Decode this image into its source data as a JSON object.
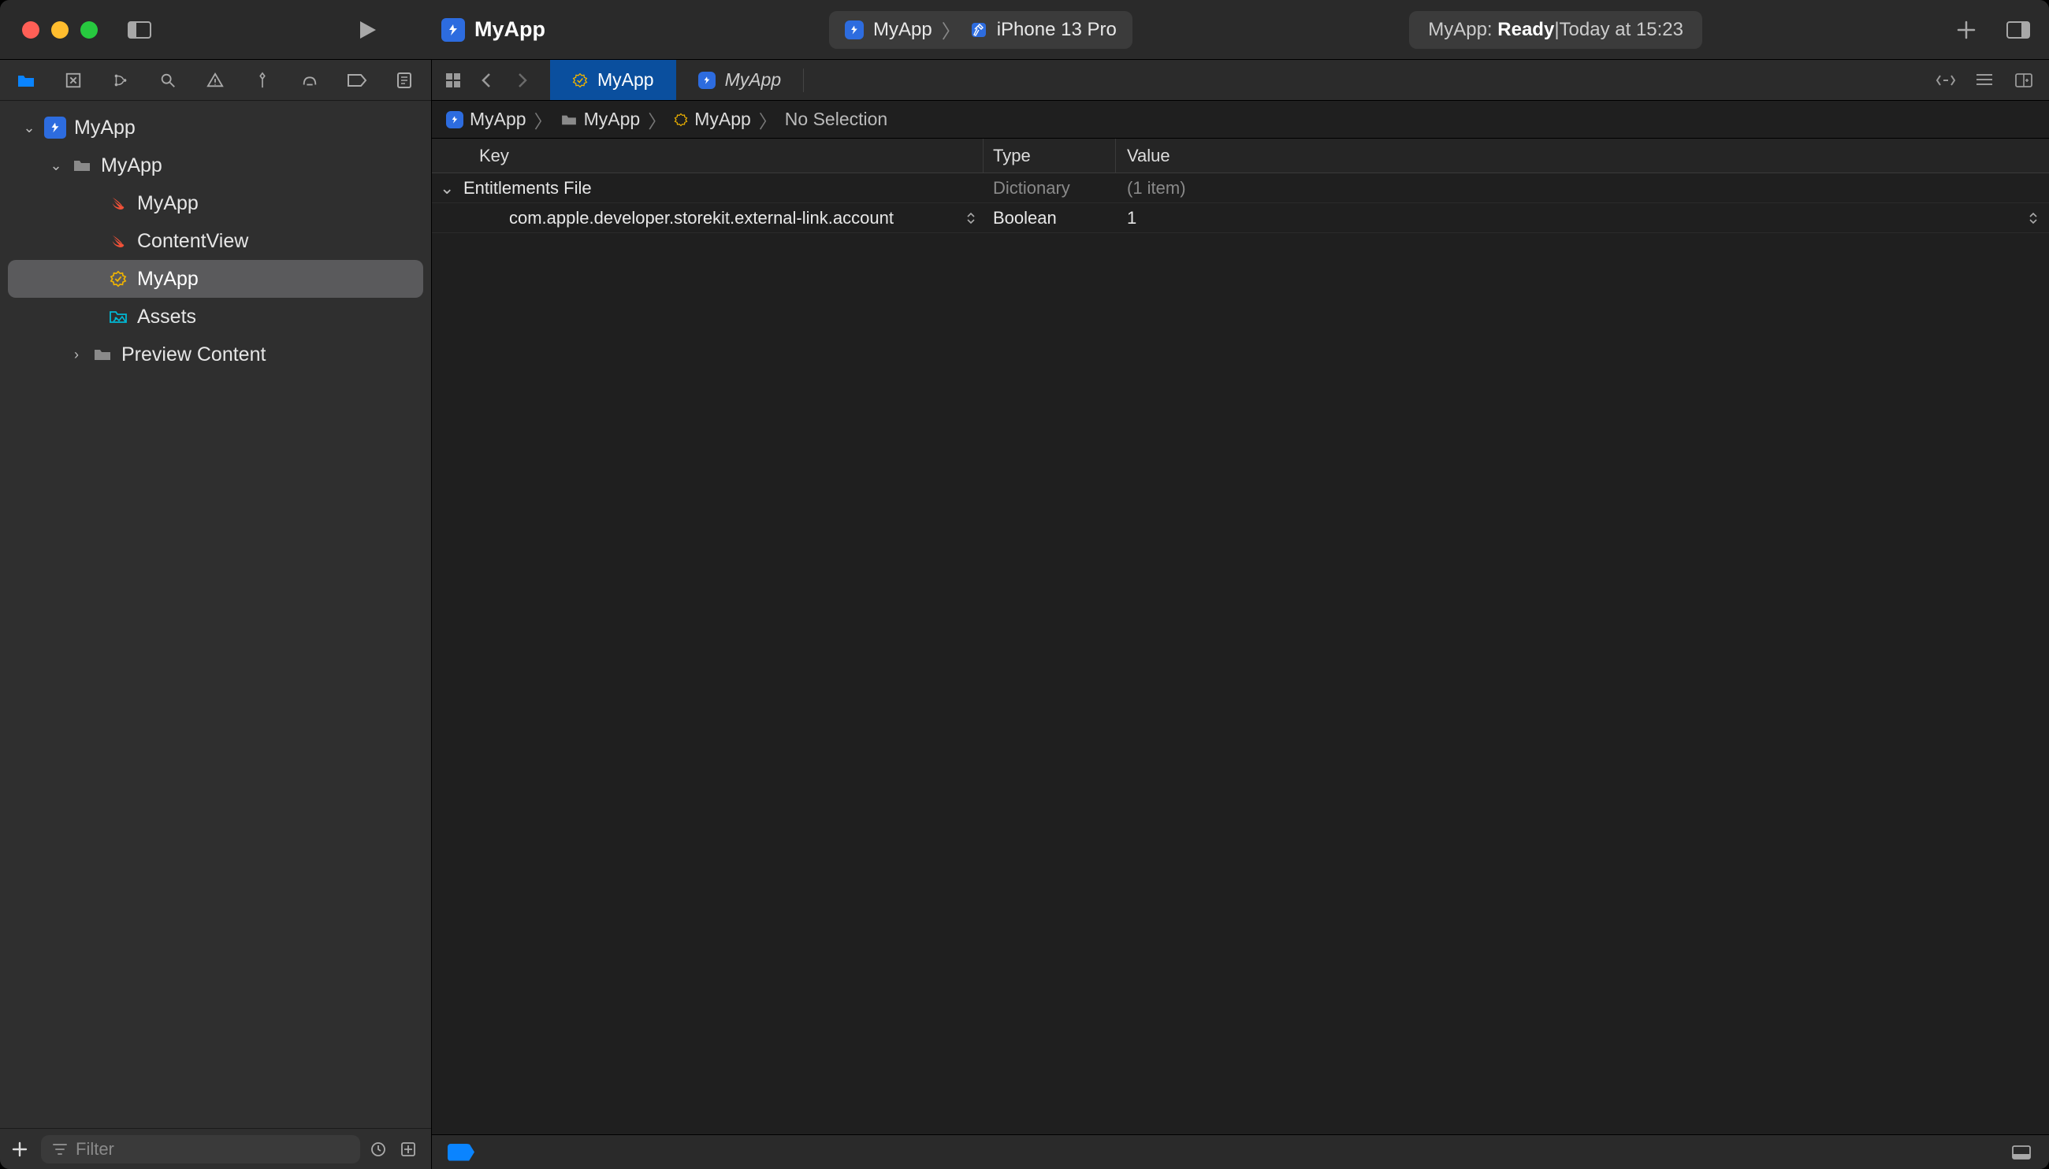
{
  "titlebar": {
    "project_name": "MyApp",
    "scheme": {
      "scheme": "MyApp",
      "destination": "iPhone 13 Pro"
    },
    "status": {
      "app": "MyApp",
      "state": "Ready",
      "sep": " | ",
      "when": "Today at 15:23"
    }
  },
  "navigator": {
    "filter_placeholder": "Filter",
    "tree": {
      "project": "MyApp",
      "group": "MyApp",
      "files": {
        "swift_app": "MyApp",
        "content_view": "ContentView",
        "entitlements": "MyApp",
        "assets": "Assets",
        "preview": "Preview Content"
      }
    }
  },
  "tabs": {
    "active": "MyApp",
    "secondary": "MyApp"
  },
  "jumpbar": {
    "segments": [
      "MyApp",
      "MyApp",
      "MyApp",
      "No Selection"
    ]
  },
  "plist": {
    "headers": {
      "key": "Key",
      "type": "Type",
      "value": "Value"
    },
    "root": {
      "key": "Entitlements File",
      "type": "Dictionary",
      "value": "(1 item)"
    },
    "rows": [
      {
        "key": "com.apple.developer.storekit.external-link.account",
        "type": "Boolean",
        "value": "1"
      }
    ]
  }
}
